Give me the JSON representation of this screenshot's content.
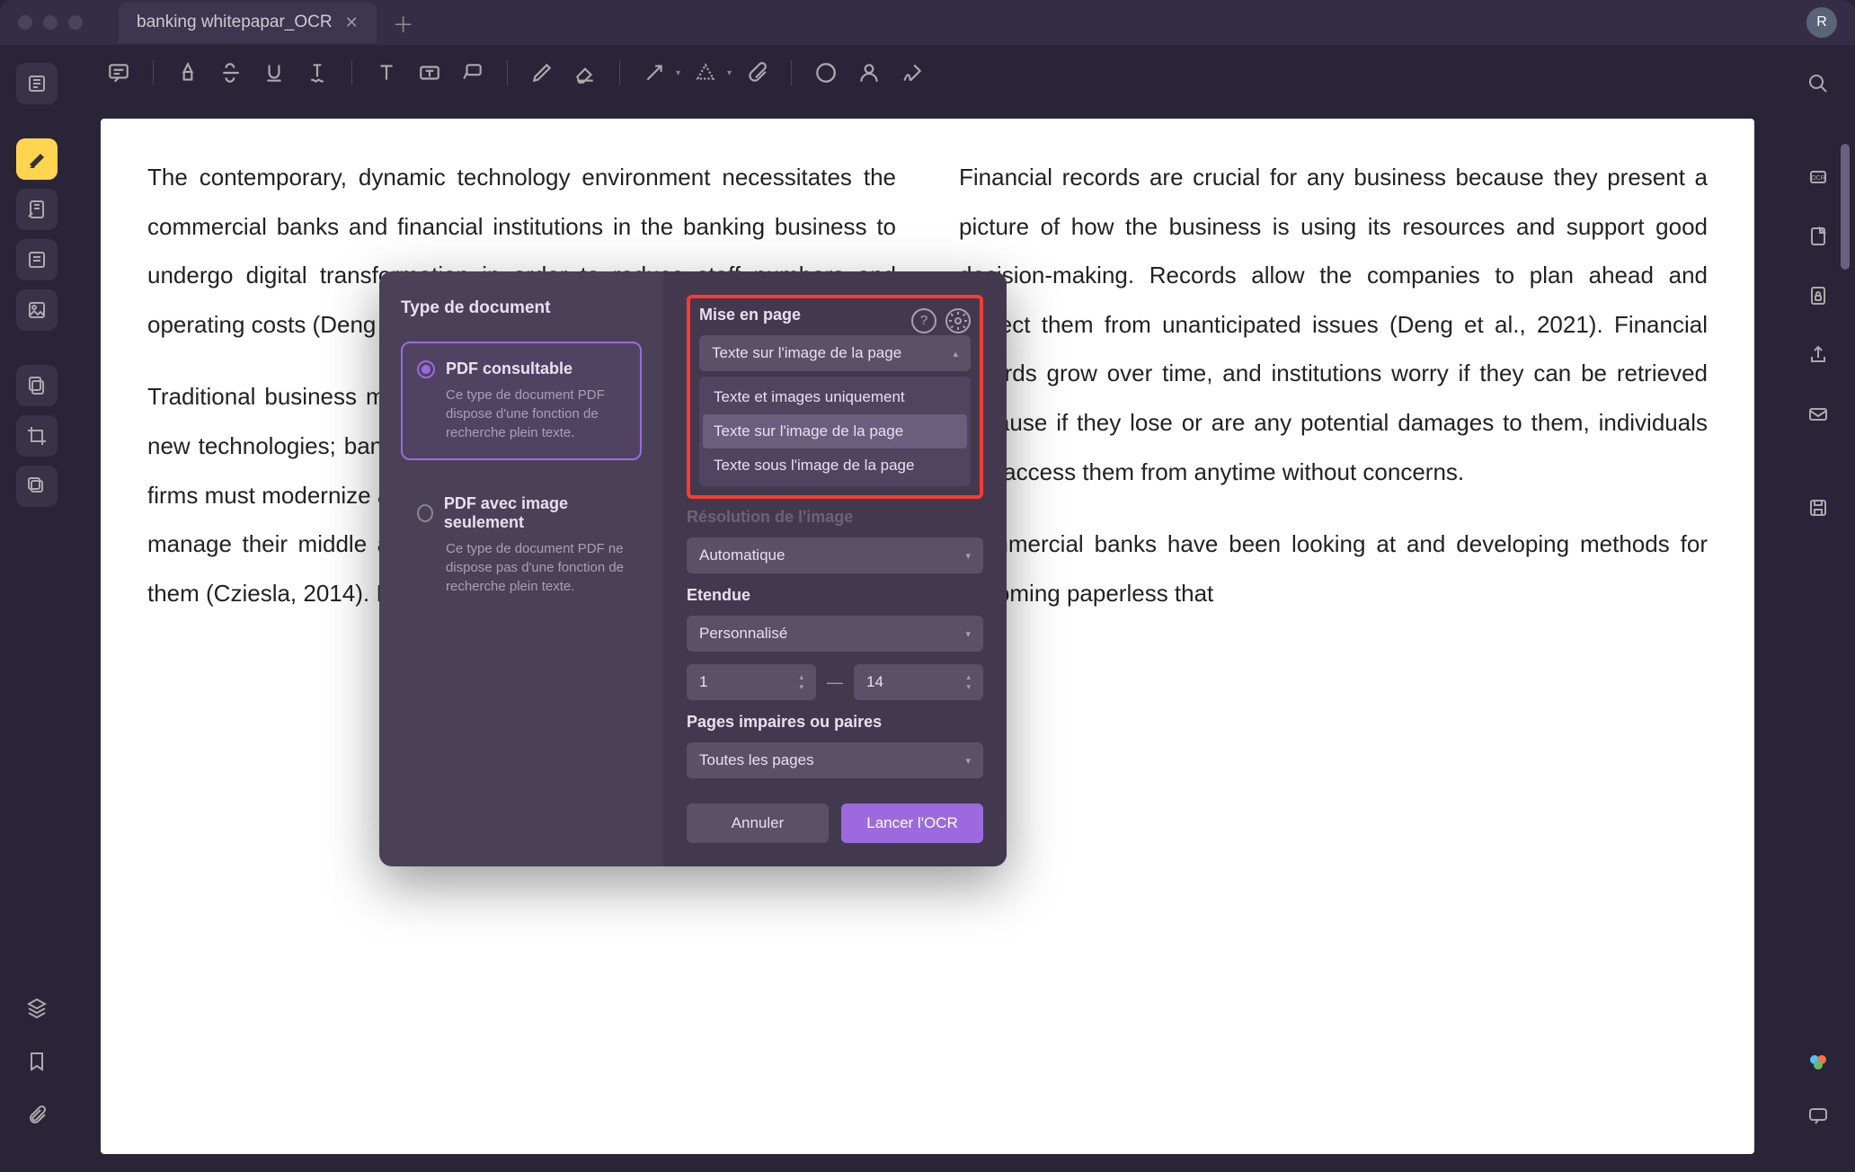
{
  "window": {
    "tab_title": "banking whitepapar_OCR",
    "avatar_initial": "R"
  },
  "document": {
    "left_column": "The contemporary, dynamic technology environment necessitates the commercial banks and financial institutions in the banking business to undergo digital transformation in order to reduce staff numbers and operating costs (Deng et al., 2021).",
    "left_column_2": "Traditional business models are evolving due to rising competition and new technologies; banks must be prepared for this. To remain relevant, firms must modernize and reconsider how they connect with consumers, manage their middle and back-office activities, and communicate with them (Cziesla, 2014). It would lower",
    "right_column_1": "Financial records are crucial for any business because they present a picture of how the business is using its resources and support good decision-making. Records allow the companies to plan ahead and protect them from unanticipated issues (Deng et al., 2021). Financial records grow over time, and institutions worry if they can be retrieved because if they lose or are any potential damages to them, individuals can access them from anytime without concerns.",
    "right_column_2": "Commercial banks have been looking at and developing methods for becoming paperless that"
  },
  "dialog": {
    "type_label": "Type de document",
    "option1": {
      "title": "PDF consultable",
      "desc": "Ce type de document PDF dispose d'une fonction de recherche plein texte."
    },
    "option2": {
      "title": "PDF avec image seulement",
      "desc": "Ce type de document PDF ne dispose pas d'une fonction de recherche plein texte."
    },
    "layout_label": "Mise en page",
    "layout_value": "Texte sur l'image de la page",
    "layout_options": [
      "Texte et images uniquement",
      "Texte sur l'image de la page",
      "Texte sous l'image de la page"
    ],
    "resolution_label": "Résolution de l'image",
    "resolution_value": "Automatique",
    "range_label": "Etendue",
    "range_value": "Personnalisé",
    "range_from": "1",
    "range_to": "14",
    "parity_label": "Pages impaires ou paires",
    "parity_value": "Toutes les pages",
    "cancel": "Annuler",
    "confirm": "Lancer l'OCR"
  },
  "icons": {
    "help": "?",
    "settings": "gear"
  }
}
